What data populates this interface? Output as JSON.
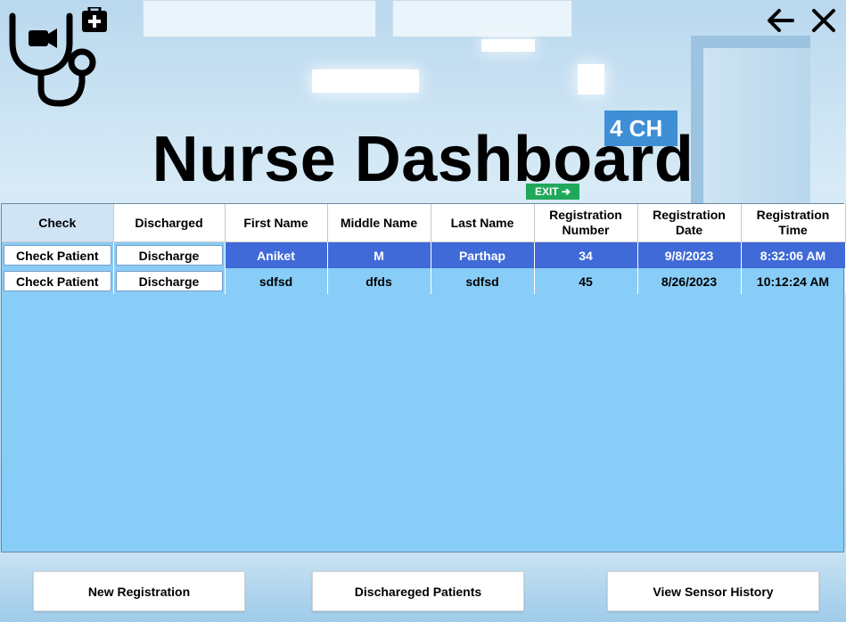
{
  "app": {
    "title": "Nurse Dashboard"
  },
  "header": {
    "back_icon": "arrow-left-icon",
    "close_icon": "close-icon",
    "logo_icon": "stethoscope-video-medkit-logo"
  },
  "table": {
    "columns": [
      "Check",
      "Discharged",
      "First Name",
      "Middle Name",
      "Last Name",
      "Registration Number",
      "Registration Date",
      "Registration Time"
    ],
    "rows": [
      {
        "check_label": "Check Patient",
        "discharge_label": "Discharge",
        "first_name": "Aniket",
        "middle_name": "M",
        "last_name": "Parthap",
        "reg_number": "34",
        "reg_date": "9/8/2023",
        "reg_time": "8:32:06 AM",
        "selected": true
      },
      {
        "check_label": "Check Patient",
        "discharge_label": "Discharge",
        "first_name": "sdfsd",
        "middle_name": "dfds",
        "last_name": "sdfsd",
        "reg_number": "45",
        "reg_date": "8/26/2023",
        "reg_time": "10:12:24 AM",
        "selected": false
      }
    ]
  },
  "actions": {
    "new_registration": "New Registration",
    "discharged_patients": "Dischareged Patients",
    "view_sensor_history": "View Sensor History"
  },
  "colors": {
    "grid_bg": "#88cdf7",
    "selected_row": "#3f6ad8",
    "header_bg": "#ffffff"
  }
}
